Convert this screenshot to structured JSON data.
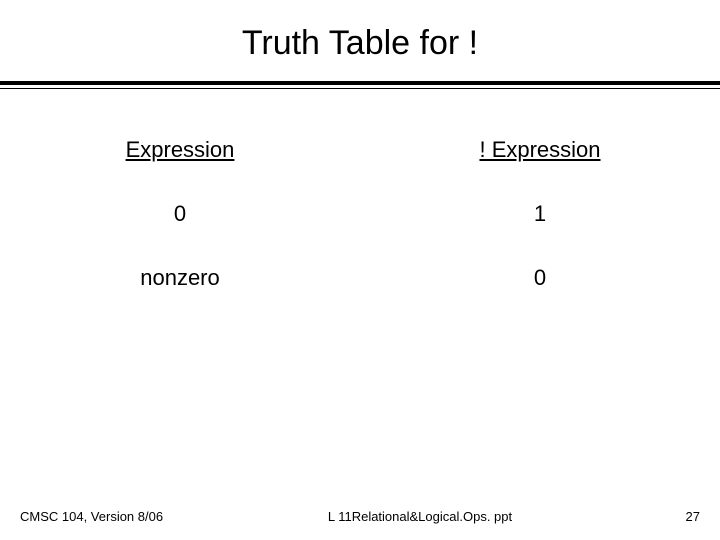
{
  "title": "Truth Table for !",
  "table": {
    "headers": {
      "left": "Expression",
      "right": "! Expression"
    },
    "rows": [
      {
        "left": "0",
        "right": "1"
      },
      {
        "left": "nonzero",
        "right": "0"
      }
    ]
  },
  "footer": {
    "left": "CMSC 104, Version 8/06",
    "center": "L 11Relational&Logical.Ops. ppt",
    "right": "27"
  }
}
